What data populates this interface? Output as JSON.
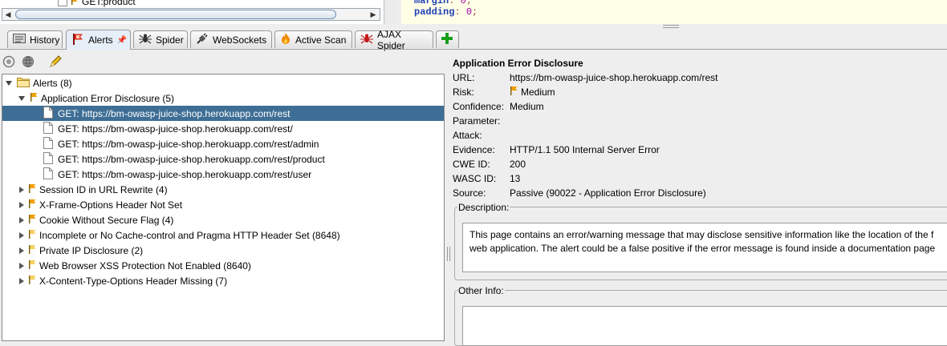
{
  "top": {
    "tree_item": "GET:product",
    "code_lines": [
      {
        "key": "margin",
        "value": "0"
      },
      {
        "key": "padding",
        "value": "0"
      }
    ]
  },
  "tabs": [
    {
      "label": "History",
      "icon": "history-icon",
      "active": false
    },
    {
      "label": "Alerts",
      "icon": "alerts-flag-icon",
      "active": true
    },
    {
      "label": "Spider",
      "icon": "spider-icon",
      "active": false
    },
    {
      "label": "WebSockets",
      "icon": "websockets-plug-icon",
      "active": false
    },
    {
      "label": "Active Scan",
      "icon": "flame-icon",
      "active": false
    },
    {
      "label": "AJAX Spider",
      "icon": "ajax-spider-icon",
      "active": false
    }
  ],
  "alerts_tree": {
    "root": "Alerts (8)",
    "groups": [
      {
        "label": "Application Error Disclosure (5)",
        "expanded": true,
        "children": [
          "GET: https://bm-owasp-juice-shop.herokuapp.com/rest",
          "GET: https://bm-owasp-juice-shop.herokuapp.com/rest/",
          "GET: https://bm-owasp-juice-shop.herokuapp.com/rest/admin",
          "GET: https://bm-owasp-juice-shop.herokuapp.com/rest/product",
          "GET: https://bm-owasp-juice-shop.herokuapp.com/rest/user"
        ]
      },
      {
        "label": "Session ID in URL Rewrite (4)"
      },
      {
        "label": "X-Frame-Options Header Not Set"
      },
      {
        "label": "Cookie Without Secure Flag (4)"
      },
      {
        "label": "Incomplete or No Cache-control and Pragma HTTP Header Set (8648)"
      },
      {
        "label": "Private IP Disclosure (2)"
      },
      {
        "label": "Web Browser XSS Protection Not Enabled (8640)"
      },
      {
        "label": "X-Content-Type-Options Header Missing (7)"
      }
    ]
  },
  "details": {
    "title": "Application Error Disclosure",
    "fields": [
      {
        "key": "URL:",
        "value": "https://bm-owasp-juice-shop.herokuapp.com/rest"
      },
      {
        "key": "Risk:",
        "value": "Medium",
        "flag": true
      },
      {
        "key": "Confidence:",
        "value": "Medium"
      },
      {
        "key": "Parameter:",
        "value": ""
      },
      {
        "key": "Attack:",
        "value": ""
      },
      {
        "key": "Evidence:",
        "value": "HTTP/1.1 500 Internal Server Error"
      },
      {
        "key": "CWE ID:",
        "value": "200"
      },
      {
        "key": "WASC ID:",
        "value": "13"
      },
      {
        "key": "Source:",
        "value": "Passive (90022 - Application Error Disclosure)"
      }
    ],
    "description_label": "Description:",
    "description_lines": [
      "This page contains an error/warning message that may disclose sensitive information like the location of the f",
      "web application. The alert could be a false positive if the error message is found inside a documentation page"
    ],
    "other_info_label": "Other Info:"
  },
  "colors": {
    "selection": "#3e6e95",
    "flag": "#f0a000"
  }
}
